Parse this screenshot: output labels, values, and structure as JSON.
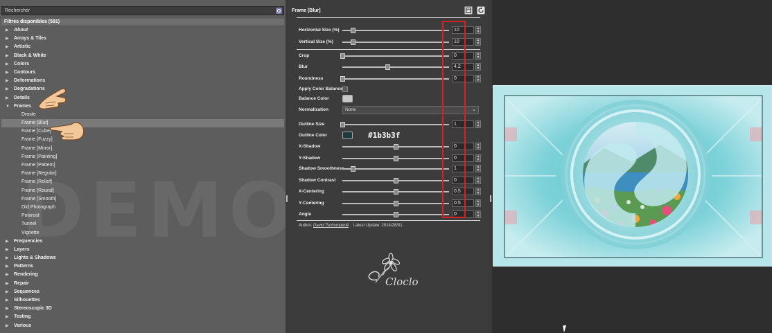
{
  "search": {
    "placeholder": "Rechercher"
  },
  "filters_header": "Filtres disponibles (591)",
  "tree": [
    {
      "label": "About",
      "type": "category",
      "expanded": false,
      "italic": true
    },
    {
      "label": "Arrays & Tiles",
      "type": "category",
      "expanded": false
    },
    {
      "label": "Artistic",
      "type": "category",
      "expanded": false
    },
    {
      "label": "Black & White",
      "type": "category",
      "expanded": false
    },
    {
      "label": "Colors",
      "type": "category",
      "expanded": false
    },
    {
      "label": "Contours",
      "type": "category",
      "expanded": false
    },
    {
      "label": "Deformations",
      "type": "category",
      "expanded": false
    },
    {
      "label": "Degradations",
      "type": "category",
      "expanded": false
    },
    {
      "label": "Details",
      "type": "category",
      "expanded": false
    },
    {
      "label": "Frames",
      "type": "category",
      "expanded": true
    },
    {
      "label": "Droste",
      "type": "child"
    },
    {
      "label": "Frame [Blur]",
      "type": "child",
      "selected": true
    },
    {
      "label": "Frame [Cube]",
      "type": "child"
    },
    {
      "label": "Frame [Fuzzy]",
      "type": "child"
    },
    {
      "label": "Frame [Mirror]",
      "type": "child"
    },
    {
      "label": "Frame [Painting]",
      "type": "child"
    },
    {
      "label": "Frame [Pattern]",
      "type": "child"
    },
    {
      "label": "Frame [Regular]",
      "type": "child"
    },
    {
      "label": "Frame [Relief]",
      "type": "child"
    },
    {
      "label": "Frame [Round]",
      "type": "child"
    },
    {
      "label": "Frame [Smooth]",
      "type": "child"
    },
    {
      "label": "Old Photograph",
      "type": "child"
    },
    {
      "label": "Polaroid",
      "type": "child"
    },
    {
      "label": "Tunnel",
      "type": "child"
    },
    {
      "label": "Vignette",
      "type": "child"
    },
    {
      "label": "Frequencies",
      "type": "category",
      "expanded": false
    },
    {
      "label": "Layers",
      "type": "category",
      "expanded": false
    },
    {
      "label": "Lights & Shadows",
      "type": "category",
      "expanded": false
    },
    {
      "label": "Patterns",
      "type": "category",
      "expanded": false
    },
    {
      "label": "Rendering",
      "type": "category",
      "expanded": false
    },
    {
      "label": "Repair",
      "type": "category",
      "expanded": false
    },
    {
      "label": "Sequences",
      "type": "category",
      "expanded": false
    },
    {
      "label": "Silhouettes",
      "type": "category",
      "expanded": false
    },
    {
      "label": "Stereoscopic 3D",
      "type": "category",
      "expanded": false
    },
    {
      "label": "Testing",
      "type": "category",
      "expanded": false
    },
    {
      "label": "Various",
      "type": "category",
      "expanded": false
    }
  ],
  "watermark": "DEMO VER",
  "filter_title": "Frame [Blur]",
  "params": [
    {
      "id": "horizontal-size",
      "label": "Horizontal Size (%)",
      "kind": "slider",
      "value": "10",
      "fraction": 0.1
    },
    {
      "id": "vertical-size",
      "label": "Vertical Size (%)",
      "kind": "slider",
      "value": "10",
      "fraction": 0.1
    },
    {
      "id": "crop",
      "label": "Crop",
      "kind": "slider",
      "value": "0",
      "fraction": 0.0
    },
    {
      "id": "blur",
      "label": "Blur",
      "kind": "slider",
      "value": "4.2",
      "fraction": 0.42
    },
    {
      "id": "roundness",
      "label": "Roundness",
      "kind": "slider",
      "value": "0",
      "fraction": 0.0
    },
    {
      "id": "apply-color-balance",
      "label": "Apply Color Balance",
      "kind": "checkbox",
      "checked": false
    },
    {
      "id": "balance-color",
      "label": "Balance Color",
      "kind": "color",
      "color": "#c8c8c8"
    },
    {
      "id": "normalization",
      "label": "Normalization",
      "kind": "select",
      "value": "None"
    },
    {
      "id": "outline-size",
      "label": "Outline Size",
      "kind": "slider",
      "value": "1",
      "fraction": 0.0
    },
    {
      "id": "outline-color",
      "label": "Outline Color",
      "kind": "color",
      "color": "#1b3b3f"
    },
    {
      "id": "x-shadow",
      "label": "X-Shadow",
      "kind": "slider",
      "value": "0",
      "fraction": 0.5
    },
    {
      "id": "y-shadow",
      "label": "Y-Shadow",
      "kind": "slider",
      "value": "0",
      "fraction": 0.5
    },
    {
      "id": "shadow-smoothness",
      "label": "Shadow Smoothness",
      "kind": "slider",
      "value": "1",
      "fraction": 0.1
    },
    {
      "id": "shadow-contrast",
      "label": "Shadow Contrast",
      "kind": "slider",
      "value": "0",
      "fraction": 0.5
    },
    {
      "id": "x-centering",
      "label": "X-Centering",
      "kind": "slider",
      "value": "0.5",
      "fraction": 0.5
    },
    {
      "id": "y-centering",
      "label": "Y-Centering",
      "kind": "slider",
      "value": "0.5",
      "fraction": 0.5
    },
    {
      "id": "angle",
      "label": "Angle",
      "kind": "slider",
      "value": "0",
      "fraction": 0.5
    }
  ],
  "outline_hex_annotation": "#1b3b3f",
  "footer": {
    "author_prefix": "Author:",
    "author_name": "David Tschumperlé",
    "updated": "Latest Update: 2014/28/01."
  },
  "logo_text": "Cloclo",
  "colors": {
    "annotation_red": "#d82020",
    "outline_color": "#1b3b3f",
    "preview_cyan": "#a7dfe5"
  }
}
